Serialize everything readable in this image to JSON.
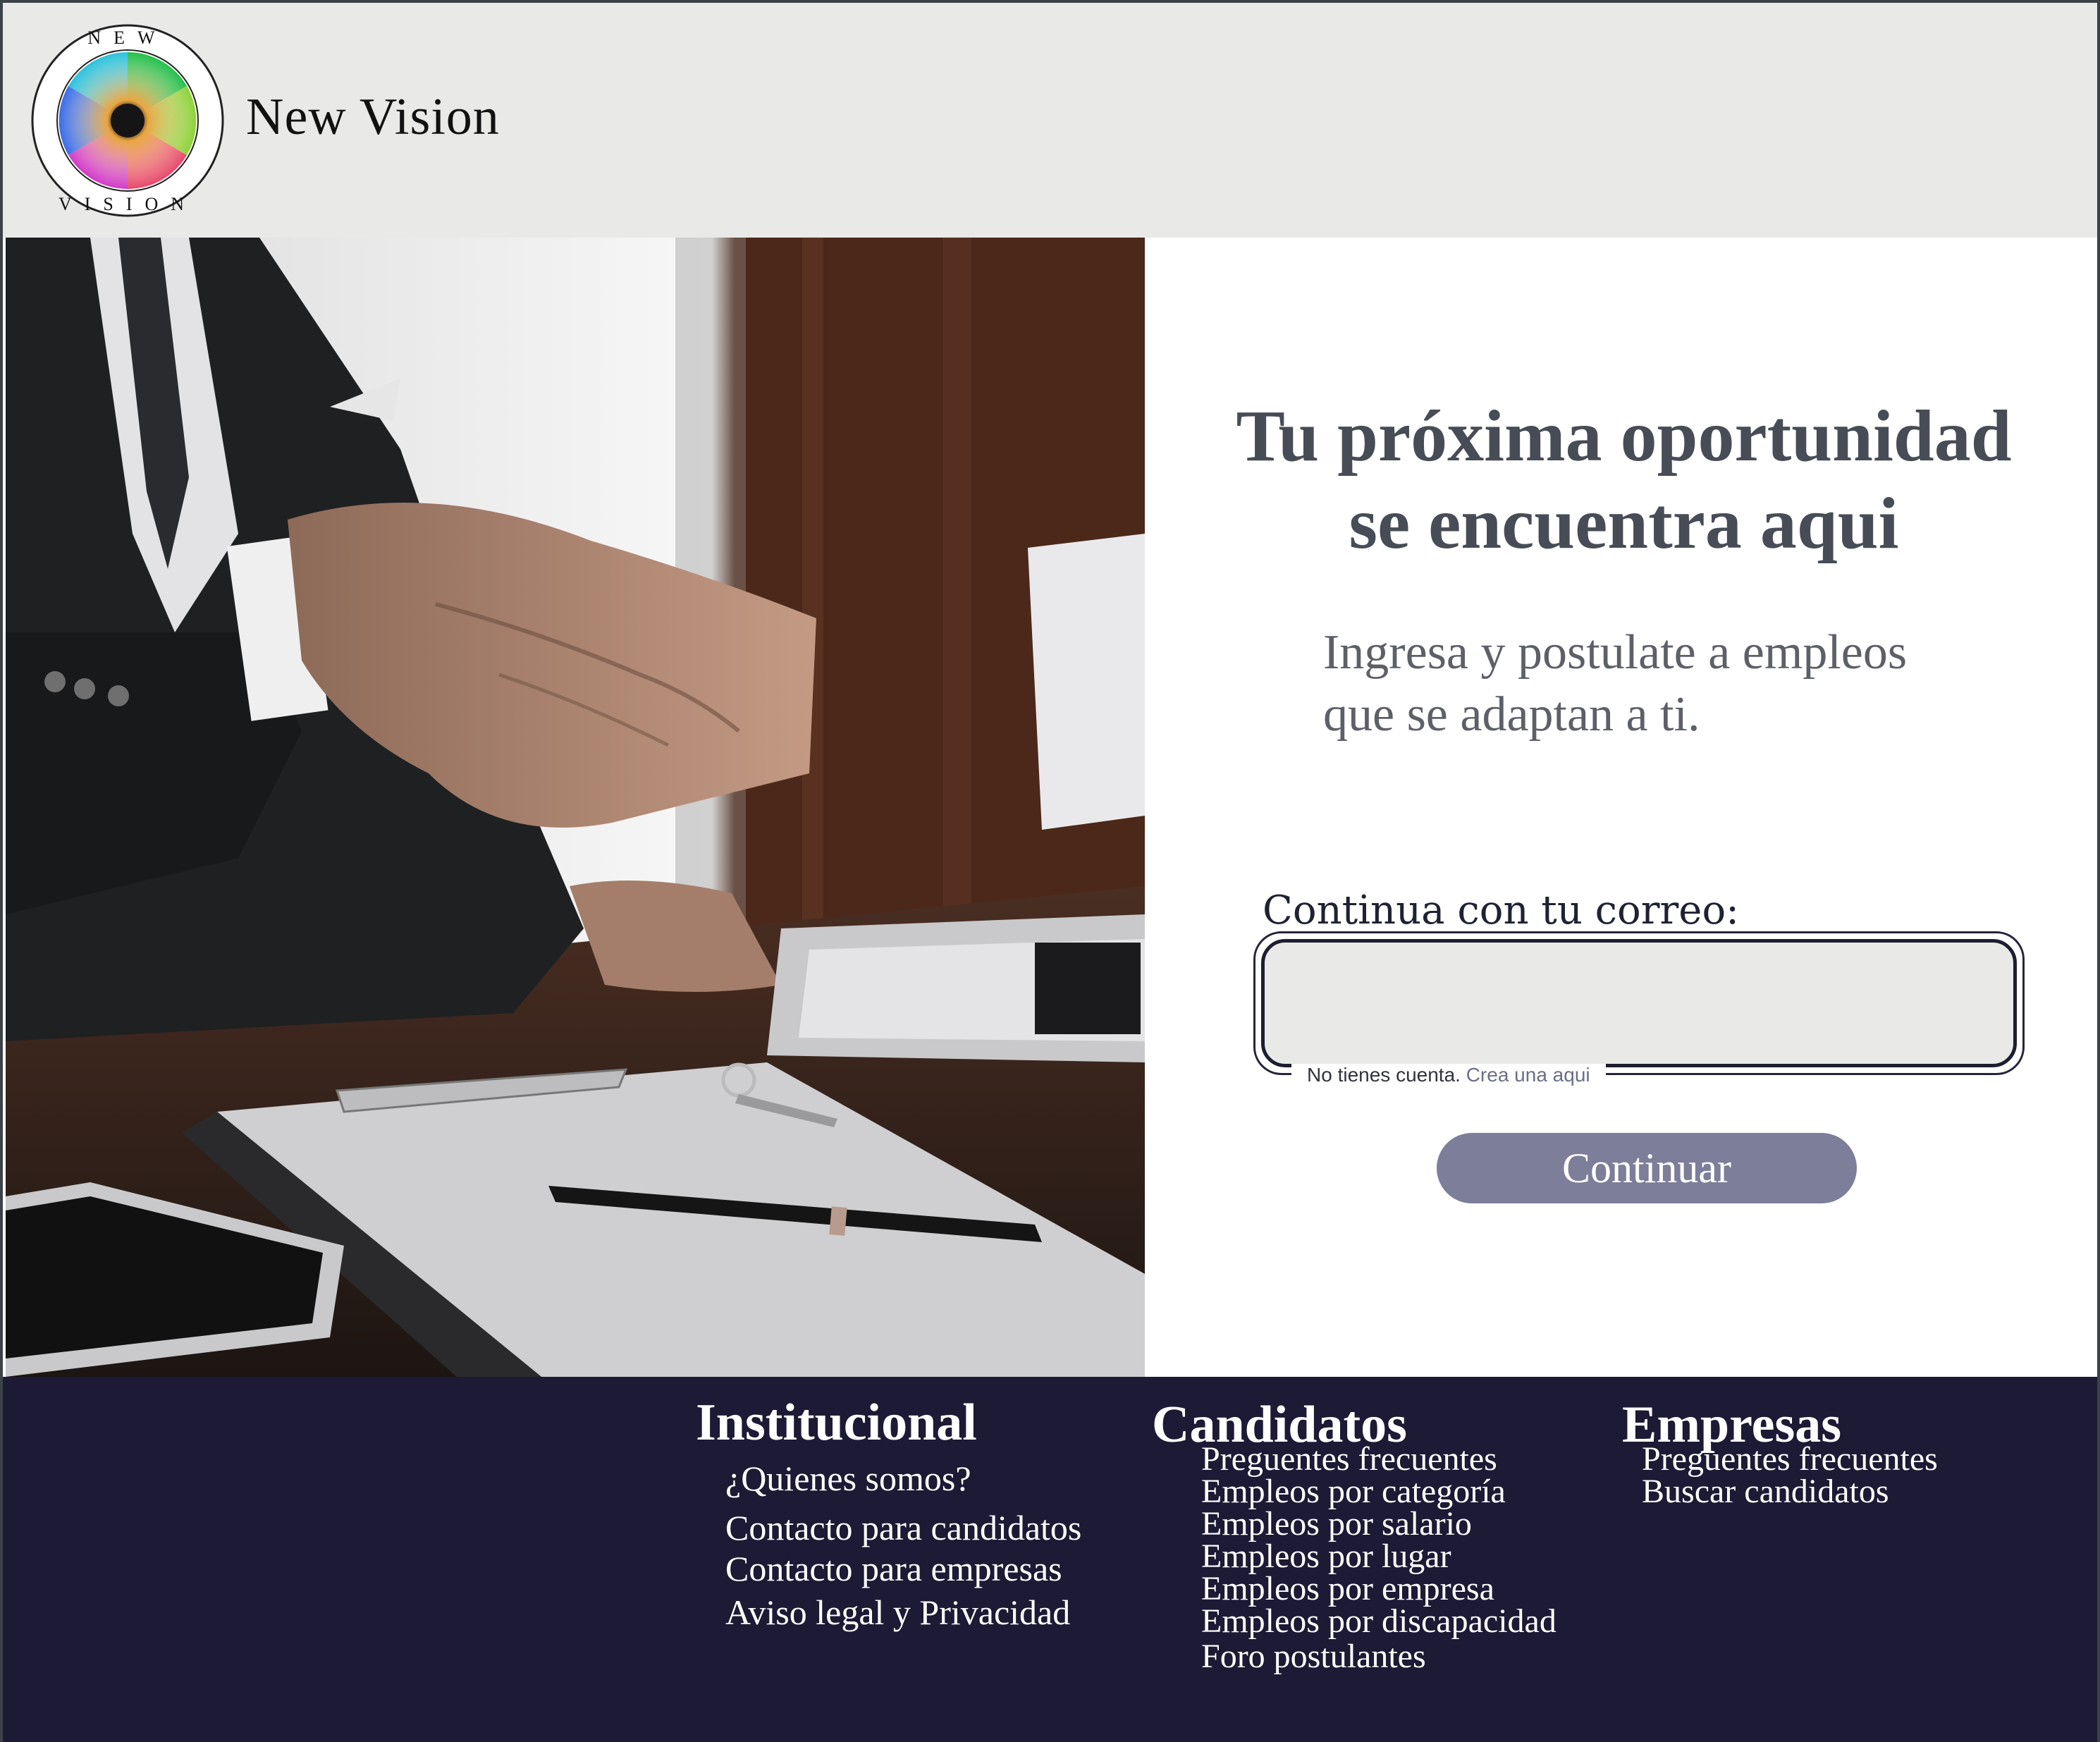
{
  "header": {
    "brand": "New Vision",
    "logo_text": "NEW VISION"
  },
  "hero": {
    "image": "handshake-office-photo"
  },
  "main": {
    "headline_line1": "Tu próxima oportunidad",
    "headline_line2": "se encuentra aqui",
    "subhead_line1": "Ingresa y postulate a empleos",
    "subhead_line2": "que se adaptan a ti.",
    "email_label": "Continua con tu correo:",
    "email_value": "",
    "email_placeholder": "",
    "no_account_text": "No tienes cuenta.",
    "create_link": "Crea una aqui",
    "continue_label": "Continuar"
  },
  "footer": {
    "institucional": {
      "title": "Institucional",
      "links": [
        "¿Quienes somos?",
        "Contacto para candidatos",
        "Contacto para  empresas",
        "Aviso legal y Privacidad"
      ]
    },
    "candidatos": {
      "title": "Candidatos",
      "links": [
        "Preguentes frecuentes",
        "Empleos por categoría",
        "Empleos por salario",
        "Empleos por lugar",
        "Empleos por empresa",
        "Empleos por discapacidad",
        "Foro postulantes"
      ]
    },
    "empresas": {
      "title": "Empresas",
      "links": [
        "Preguentes frecuentes",
        "Buscar candidatos"
      ]
    }
  },
  "colors": {
    "header_bg": "#e9e9e8",
    "footer_bg": "#1d1a35",
    "headline": "#474c56",
    "button": "#7d7e9a"
  }
}
